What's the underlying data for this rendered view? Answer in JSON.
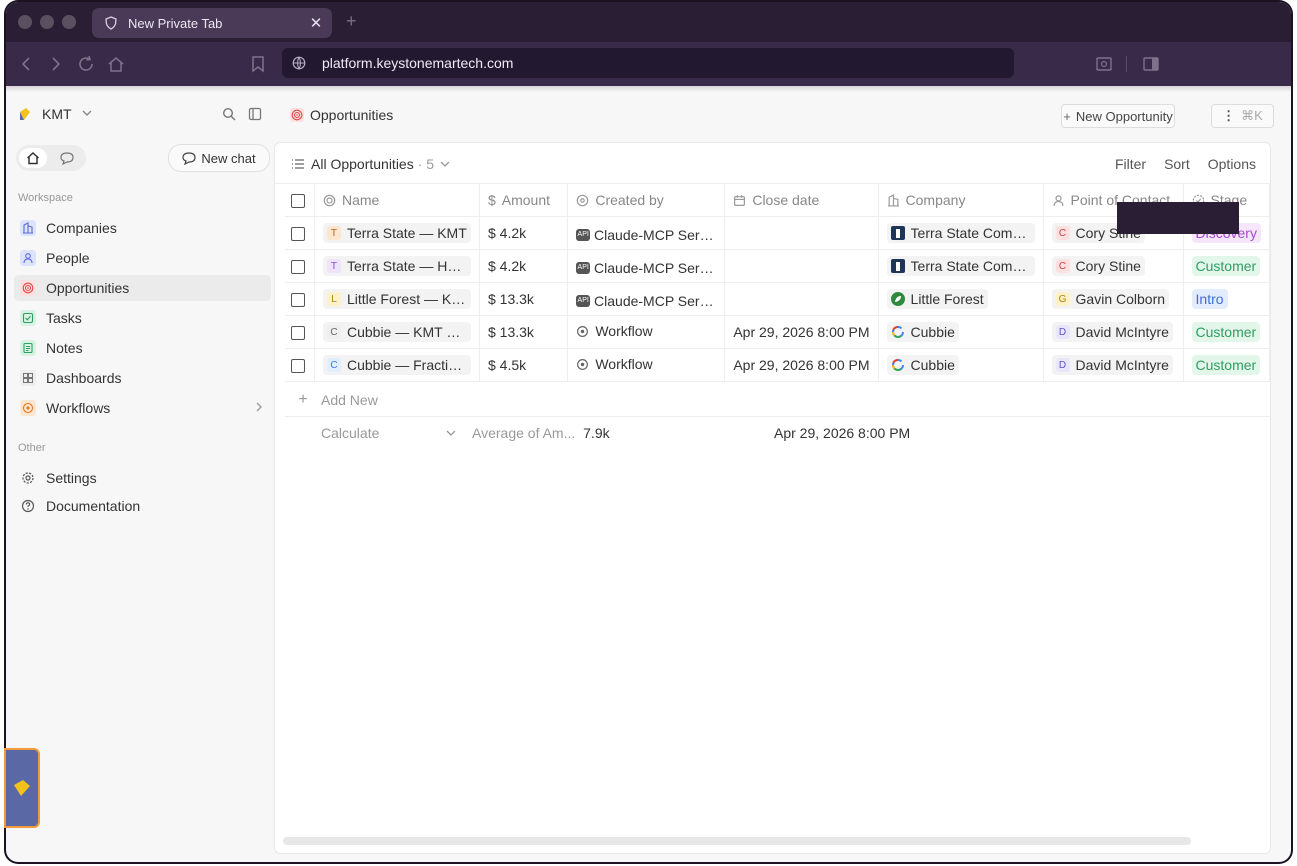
{
  "browser": {
    "tab_title": "New Private Tab",
    "tab_close": "✕",
    "new_tab": "+",
    "url": "platform.keystonemartech.com"
  },
  "sidebar": {
    "workspace_name": "KMT",
    "new_chat_label": "New chat",
    "workspace_section": "Workspace",
    "other_section": "Other",
    "items": [
      {
        "label": "Companies",
        "icon": "building-icon",
        "color": "#dde3fb",
        "icon_color": "#5b6bd6"
      },
      {
        "label": "People",
        "icon": "person-icon",
        "color": "#dde3fb",
        "icon_color": "#5b6bd6"
      },
      {
        "label": "Opportunities",
        "icon": "target-icon",
        "color": "#fde0e0",
        "icon_color": "#e04848"
      },
      {
        "label": "Tasks",
        "icon": "checkbox-icon",
        "color": "#d8f3e4",
        "icon_color": "#2e9e63"
      },
      {
        "label": "Notes",
        "icon": "note-icon",
        "color": "#d8f3e4",
        "icon_color": "#2e9e63"
      },
      {
        "label": "Dashboards",
        "icon": "dashboard-icon",
        "color": "#eeeeee",
        "icon_color": "#777777"
      },
      {
        "label": "Workflows",
        "icon": "workflow-icon",
        "color": "#fde6cf",
        "icon_color": "#e07a1f"
      }
    ],
    "other_items": [
      {
        "label": "Settings",
        "icon": "gear-icon"
      },
      {
        "label": "Documentation",
        "icon": "help-icon"
      }
    ]
  },
  "header": {
    "page_title": "Opportunities",
    "new_button": "New Opportunity",
    "shortcut": "⌘K"
  },
  "view": {
    "name": "All Opportunities",
    "count": "· 5",
    "actions": [
      "Filter",
      "Sort",
      "Options"
    ]
  },
  "table": {
    "columns": [
      "Name",
      "Amount",
      "Created by",
      "Close date",
      "Company",
      "Point of Contact",
      "Stage"
    ],
    "rows": [
      {
        "name": "Terra State — KMT",
        "avatar": "T",
        "avatar_bg": "#fde6cf",
        "avatar_fg": "#b56a1f",
        "amount": "4.2k",
        "created_by": "Claude-MCP Server",
        "creator_type": "api",
        "close_date": "",
        "company": "Terra State Community",
        "company_logo": "terra-logo-icon",
        "contact": "Cory Stine",
        "contact_avatar": "C",
        "contact_bg": "#fde0e0",
        "contact_fg": "#d04040",
        "stage": "Discovery",
        "stage_bg": "#f5e6fb",
        "stage_fg": "#a84ad1"
      },
      {
        "name": "Terra State — Health",
        "avatar": "T",
        "avatar_bg": "#efe3fb",
        "avatar_fg": "#8a52c6",
        "amount": "4.2k",
        "created_by": "Claude-MCP Server",
        "creator_type": "api",
        "close_date": "",
        "company": "Terra State Community",
        "company_logo": "terra-logo-icon",
        "contact": "Cory Stine",
        "contact_avatar": "C",
        "contact_bg": "#fde0e0",
        "contact_fg": "#d04040",
        "stage": "Customer",
        "stage_bg": "#e3f6ea",
        "stage_fg": "#2e9e63"
      },
      {
        "name": "Little Forest — KMT",
        "avatar": "L",
        "avatar_bg": "#fdf1c7",
        "avatar_fg": "#a88411",
        "amount": "13.3k",
        "created_by": "Claude-MCP Server",
        "creator_type": "api",
        "close_date": "",
        "company": "Little Forest",
        "company_logo": "leaf-logo-icon",
        "contact": "Gavin Colborn",
        "contact_avatar": "G",
        "contact_bg": "#fdf1c7",
        "contact_fg": "#a88411",
        "stage": "Intro",
        "stage_bg": "#e3ecfd",
        "stage_fg": "#3d6ed6"
      },
      {
        "name": "Cubbie — KMT Strategy",
        "avatar": "C",
        "avatar_bg": "#eeeeee",
        "avatar_fg": "#666666",
        "amount": "13.3k",
        "created_by": "Workflow",
        "creator_type": "workflow",
        "close_date": "Apr 29, 2026 8:00 PM",
        "company": "Cubbie",
        "company_logo": "google-logo-icon",
        "contact": "David McIntyre",
        "contact_avatar": "D",
        "contact_bg": "#e8e6fb",
        "contact_fg": "#5b52c6",
        "stage": "Customer",
        "stage_bg": "#e3f6ea",
        "stage_fg": "#2e9e63"
      },
      {
        "name": "Cubbie — Fractional",
        "avatar": "C",
        "avatar_bg": "#e0eefd",
        "avatar_fg": "#3d7ed6",
        "amount": "4.5k",
        "created_by": "Workflow",
        "creator_type": "workflow",
        "close_date": "Apr 29, 2026 8:00 PM",
        "company": "Cubbie",
        "company_logo": "google-logo-icon",
        "contact": "David McIntyre",
        "contact_avatar": "D",
        "contact_bg": "#e8e6fb",
        "contact_fg": "#5b52c6",
        "stage": "Customer",
        "stage_bg": "#e3f6ea",
        "stage_fg": "#2e9e63"
      }
    ],
    "add_new": "Add New",
    "calculate": "Calculate",
    "aggregate_label": "Average of Am...",
    "aggregate_value": "7.9k",
    "aggregate_date": "Apr 29, 2026 8:00 PM"
  }
}
